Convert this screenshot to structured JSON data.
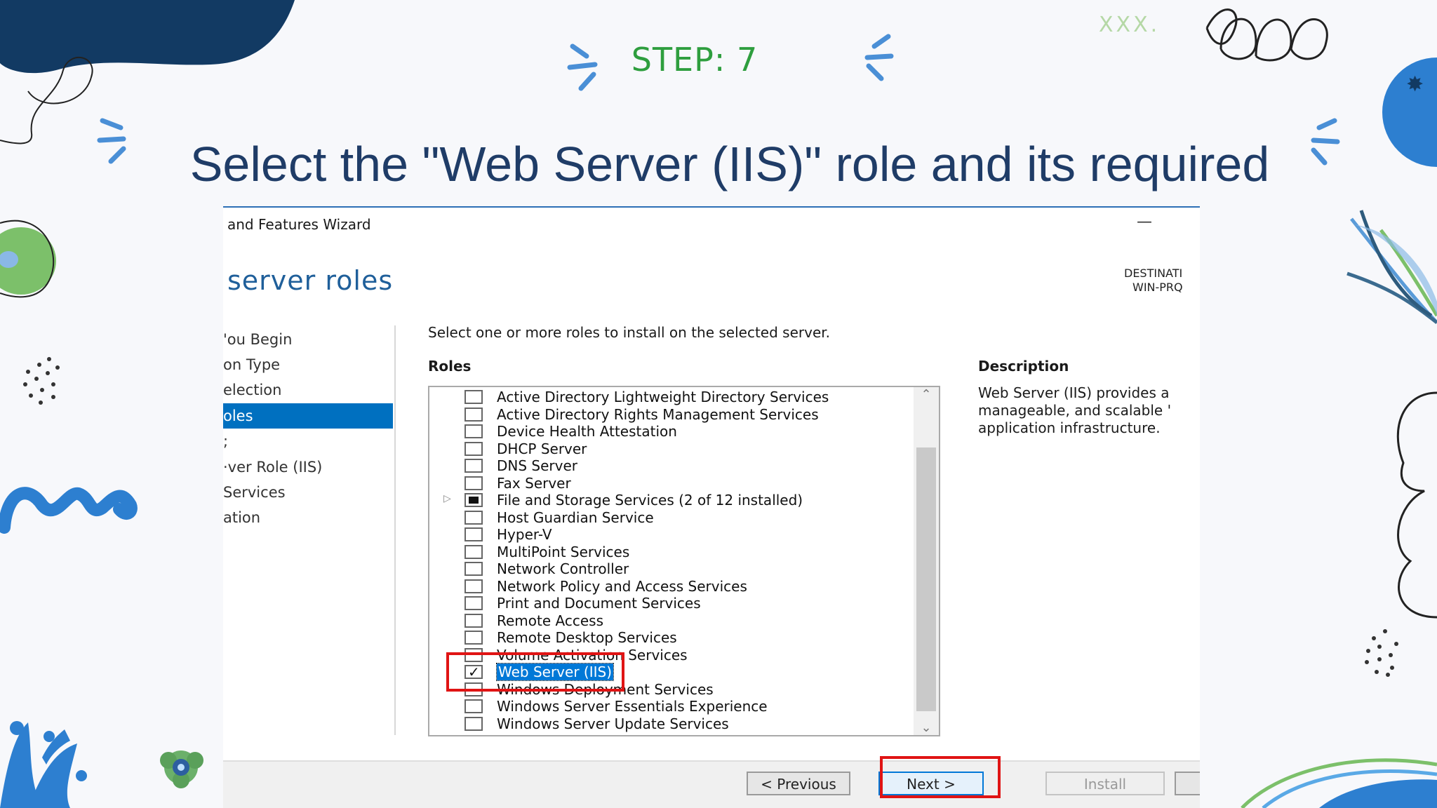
{
  "slide": {
    "step_label": "STEP: 7",
    "decor_text": "XXX.",
    "headline": "Select the \"Web Server (IIS)\" role and its required features"
  },
  "wizard": {
    "title": "and Features Wizard",
    "minimize_glyph": "—",
    "heading": "server roles",
    "destination_label": "DESTINATI",
    "destination_server": "WIN-PRQ",
    "nav": [
      {
        "label": "'ou Begin"
      },
      {
        "label": "on Type"
      },
      {
        "label": "election"
      },
      {
        "label": "oles",
        "active": true
      },
      {
        "label": ";"
      },
      {
        "label": "·ver Role (IIS)"
      },
      {
        "label": "Services"
      },
      {
        "label": "ation"
      }
    ],
    "instruction": "Select one or more roles to install on the selected server.",
    "roles_header": "Roles",
    "description_header": "Description",
    "description_text": "Web Server (IIS) provides a\nmanageable, and scalable '\napplication infrastructure.",
    "roles": [
      {
        "label": "Active Directory Lightweight Directory Services",
        "state": "unchecked"
      },
      {
        "label": "Active Directory Rights Management Services",
        "state": "unchecked"
      },
      {
        "label": "Device Health Attestation",
        "state": "unchecked"
      },
      {
        "label": "DHCP Server",
        "state": "unchecked"
      },
      {
        "label": "DNS Server",
        "state": "unchecked"
      },
      {
        "label": "Fax Server",
        "state": "unchecked"
      },
      {
        "label": "File and Storage Services (2 of 12 installed)",
        "state": "partial",
        "expandable": true
      },
      {
        "label": "Host Guardian Service",
        "state": "unchecked"
      },
      {
        "label": "Hyper-V",
        "state": "unchecked"
      },
      {
        "label": "MultiPoint Services",
        "state": "unchecked"
      },
      {
        "label": "Network Controller",
        "state": "unchecked"
      },
      {
        "label": "Network Policy and Access Services",
        "state": "unchecked"
      },
      {
        "label": "Print and Document Services",
        "state": "unchecked"
      },
      {
        "label": "Remote Access",
        "state": "unchecked"
      },
      {
        "label": "Remote Desktop Services",
        "state": "unchecked"
      },
      {
        "label": "Volume Activation Services",
        "state": "unchecked"
      },
      {
        "label": "Web Server (IIS)",
        "state": "checked",
        "selected": true
      },
      {
        "label": "Windows Deployment Services",
        "state": "unchecked"
      },
      {
        "label": "Windows Server Essentials Experience",
        "state": "unchecked"
      },
      {
        "label": "Windows Server Update Services",
        "state": "unchecked"
      }
    ],
    "buttons": {
      "previous": "< Previous",
      "next": "Next >",
      "install": "Install"
    }
  },
  "colors": {
    "step_green": "#2e9e3e",
    "headline_navy": "#1f3c67",
    "selection_blue": "#0078d7",
    "highlight_red": "#e01414"
  }
}
